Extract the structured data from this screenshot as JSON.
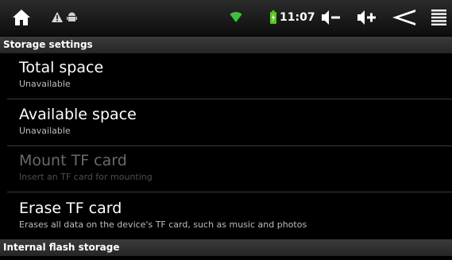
{
  "status_bar": {
    "time": "11:07",
    "icons": [
      "home-icon",
      "warning-icon",
      "android-debug-icon",
      "wifi-icon",
      "battery-icon",
      "volume-down-icon",
      "volume-up-icon",
      "back-icon",
      "menu-icon"
    ]
  },
  "sections": {
    "storage_settings": "Storage settings",
    "internal_flash": "Internal flash storage"
  },
  "prefs": {
    "total_space": {
      "title": "Total space",
      "summary": "Unavailable"
    },
    "available_space": {
      "title": "Available space",
      "summary": "Unavailable"
    },
    "mount_tf": {
      "title": "Mount TF card",
      "summary": "Insert an TF card for mounting"
    },
    "erase_tf": {
      "title": "Erase TF card",
      "summary": "Erases all data on the device's TF card, such as music and photos"
    }
  },
  "colors": {
    "statusbar_bg": "#1a1a1a",
    "section_bg": "#333333",
    "disabled_text": "#6a6a6a",
    "wifi": "#3fbf3f",
    "battery": "#59c41f"
  }
}
